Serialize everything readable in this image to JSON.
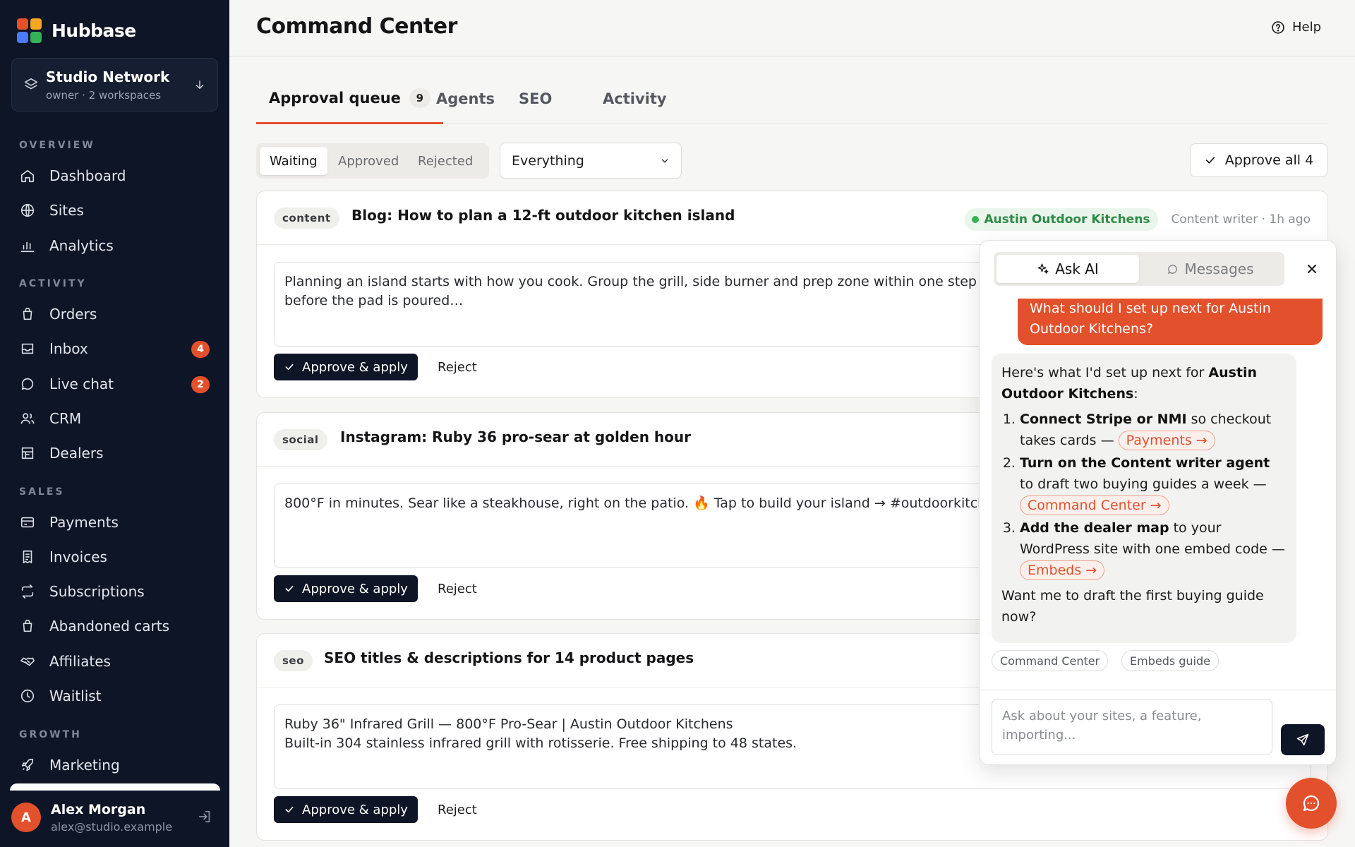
{
  "brand": {
    "name": "Hubbase"
  },
  "workspace": {
    "name": "Studio Network",
    "sub": "owner · 2 workspaces"
  },
  "sidebar": {
    "sections": [
      "OVERVIEW",
      "ACTIVITY",
      "SALES",
      "GROWTH"
    ],
    "items": [
      {
        "label": "Dashboard",
        "icon": "home-icon"
      },
      {
        "label": "Sites",
        "icon": "globe-icon"
      },
      {
        "label": "Analytics",
        "icon": "bar-chart-icon"
      },
      {
        "label": "Orders",
        "icon": "bag-icon"
      },
      {
        "label": "Inbox",
        "icon": "inbox-icon",
        "badge": "4"
      },
      {
        "label": "Live chat",
        "icon": "chat-bubble-icon",
        "badge": "2"
      },
      {
        "label": "CRM",
        "icon": "users-icon"
      },
      {
        "label": "Dealers",
        "icon": "store-icon"
      },
      {
        "label": "Payments",
        "icon": "credit-card-icon"
      },
      {
        "label": "Invoices",
        "icon": "receipt-icon"
      },
      {
        "label": "Subscriptions",
        "icon": "repeat-icon"
      },
      {
        "label": "Abandoned carts",
        "icon": "bag-icon"
      },
      {
        "label": "Affiliates",
        "icon": "handshake-icon"
      },
      {
        "label": "Waitlist",
        "icon": "clock-icon"
      },
      {
        "label": "Marketing",
        "icon": "rocket-icon"
      }
    ]
  },
  "user": {
    "initial": "A",
    "name": "Alex Morgan",
    "email": "alex@studio.example"
  },
  "header": {
    "title": "Command Center",
    "help": "Help"
  },
  "tabs": [
    {
      "label": "Approval queue",
      "count": "9"
    },
    {
      "label": "Agents"
    },
    {
      "label": "SEO"
    },
    {
      "label": "Activity"
    }
  ],
  "filters": {
    "segments": [
      "Waiting",
      "Approved",
      "Rejected"
    ],
    "select_value": "Everything",
    "approve_all": "Approve all 4"
  },
  "cards": [
    {
      "chip": "content",
      "title": "Blog: How to plan a 12-ft outdoor kitchen island",
      "site": "Austin Outdoor Kitchens",
      "meta": "Content writer · 1h ago",
      "text": "Planning an island starts with how you cook. Group the grill, side burner and prep zone within one step of each other on the grill side, and plan utilities before the pad is poured…",
      "approve": "Approve & apply",
      "reject": "Reject"
    },
    {
      "chip": "social",
      "title": "Instagram: Ruby 36 pro-sear at golden hour",
      "text": "800°F in minutes. Sear like a steakhouse, right on the patio. 🔥 Tap to build your island → #outdoorkitchen #infraredgrill",
      "approve": "Approve & apply",
      "reject": "Reject"
    },
    {
      "chip": "seo",
      "title": "SEO titles & descriptions for 14 product pages",
      "text": "Ruby 36\" Infrared Grill — 800°F Pro-Sear | Austin Outdoor Kitchens\nBuilt-in 304 stainless infrared grill with rotisserie. Free shipping to 48 states.",
      "approve": "Approve & apply",
      "reject": "Reject"
    }
  ],
  "chat": {
    "tabs": [
      "Ask AI",
      "Messages"
    ],
    "user_message": "What should I set up next for Austin Outdoor Kitchens?",
    "ai": {
      "intro_pre": "Here's what I'd set up next for ",
      "intro_bold": "Austin Outdoor Kitchens",
      "intro_post": ":",
      "steps": [
        {
          "bold": "Connect Stripe or NMI",
          "text": " so checkout takes cards — ",
          "link": "Payments →"
        },
        {
          "bold": "Turn on the Content writer agent",
          "text": " to draft two buying guides a week — ",
          "link": "Command Center →"
        },
        {
          "bold": "Add the dealer map",
          "text": " to your WordPress site with one embed code — ",
          "link": "Embeds →"
        }
      ],
      "outro": "Want me to draft the first buying guide now?"
    },
    "suggestions": [
      "Command Center",
      "Embeds guide"
    ],
    "input_placeholder": "Ask about your sites, a feature, importing..."
  },
  "colors": {
    "accent": "#e2502c",
    "sidebar": "#0e1526",
    "success": "#34b255"
  }
}
